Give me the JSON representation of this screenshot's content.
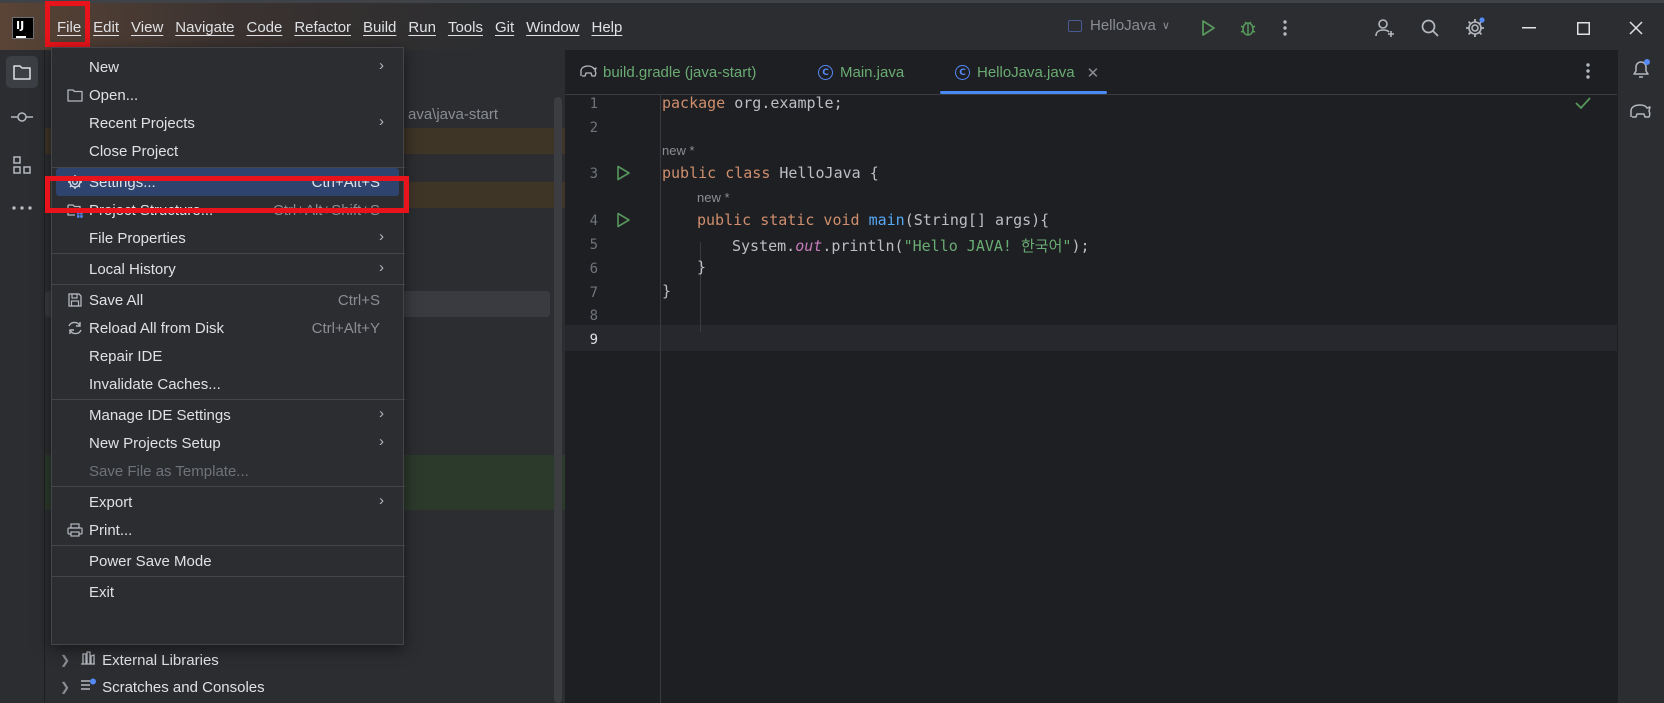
{
  "menubar": {
    "items": [
      "File",
      "Edit",
      "View",
      "Navigate",
      "Code",
      "Refactor",
      "Build",
      "Run",
      "Tools",
      "Git",
      "Window",
      "Help"
    ]
  },
  "toolbar": {
    "run_config": "HelloJava"
  },
  "project_panel": {
    "path_text": "ava\\java-start",
    "external_libraries": "External Libraries",
    "scratches": "Scratches and Consoles"
  },
  "file_menu": {
    "items": [
      {
        "label": "New",
        "shortcut": ""
      },
      {
        "label": "Open...",
        "shortcut": ""
      },
      {
        "label": "Recent Projects",
        "shortcut": ""
      },
      {
        "label": "Close Project",
        "shortcut": ""
      },
      {
        "label": "Settings...",
        "shortcut": "Ctrl+Alt+S"
      },
      {
        "label": "Project Structure...",
        "shortcut": "Ctrl+Alt+Shift+S"
      },
      {
        "label": "File Properties",
        "shortcut": ""
      },
      {
        "label": "Local History",
        "shortcut": ""
      },
      {
        "label": "Save All",
        "shortcut": "Ctrl+S"
      },
      {
        "label": "Reload All from Disk",
        "shortcut": "Ctrl+Alt+Y"
      },
      {
        "label": "Repair IDE",
        "shortcut": ""
      },
      {
        "label": "Invalidate Caches...",
        "shortcut": ""
      },
      {
        "label": "Manage IDE Settings",
        "shortcut": ""
      },
      {
        "label": "New Projects Setup",
        "shortcut": ""
      },
      {
        "label": "Save File as Template...",
        "shortcut": ""
      },
      {
        "label": "Export",
        "shortcut": ""
      },
      {
        "label": "Print...",
        "shortcut": ""
      },
      {
        "label": "Power Save Mode",
        "shortcut": ""
      },
      {
        "label": "Exit",
        "shortcut": ""
      }
    ]
  },
  "editor": {
    "tabs": [
      "build.gradle (java-start)",
      "Main.java",
      "HelloJava.java"
    ],
    "active_tab": "HelloJava.java",
    "hint": "new *",
    "line_numbers": [
      "1",
      "2",
      "3",
      "4",
      "5",
      "6",
      "7",
      "8",
      "9"
    ],
    "code": {
      "l1_kw": "package",
      "l1_rest": " org.example;",
      "l3_kw": "public class",
      "l3_rest": " HelloJava {",
      "l4_kw": "public static void",
      "l4_fn": " main",
      "l4_rest": "(String[] args){",
      "l5_a": "System.",
      "l5_out": "out",
      "l5_b": ".println(",
      "l5_str": "\"Hello JAVA! 한국어\"",
      "l5_c": ");",
      "l6": "}",
      "l7": "}"
    }
  },
  "colors": {
    "accent": "#4a8af4",
    "highlight_box": "#e8131b",
    "selection": "#2e436e"
  }
}
